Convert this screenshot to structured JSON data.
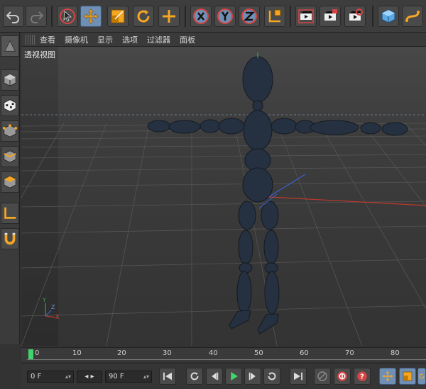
{
  "viewport_menu": [
    "查看",
    "摄像机",
    "显示",
    "选项",
    "过滤器",
    "面板"
  ],
  "viewport_title": "透视视图",
  "timeline_ticks": [
    "0",
    "10",
    "20",
    "30",
    "40",
    "50",
    "60",
    "70",
    "80"
  ],
  "transport": {
    "current_frame": "0 F",
    "end_frame": "90 F"
  },
  "colors": {
    "accent_orange": "#f5a623",
    "play_green": "#41d36c",
    "record_red": "#d64545",
    "axis_blue": "#6f8fb5"
  },
  "toolbar_icons": [
    "undo-icon",
    "redo-icon",
    "live-select-icon",
    "move-icon",
    "scale-icon",
    "rotate-icon",
    "add-icon",
    "x-axis-icon",
    "y-axis-icon",
    "z-axis-icon",
    "world-coord-icon",
    "render-view-icon",
    "render-picture-viewer-icon",
    "render-settings-icon",
    "cube-icon",
    "spline-pen-icon"
  ],
  "left_icons": [
    "model-mode-icon",
    "object-mode-icon",
    "texture-mode-icon",
    "points-mode-icon",
    "edges-mode-icon",
    "polygons-mode-icon",
    "axis-mode-icon",
    "magnet-icon"
  ]
}
